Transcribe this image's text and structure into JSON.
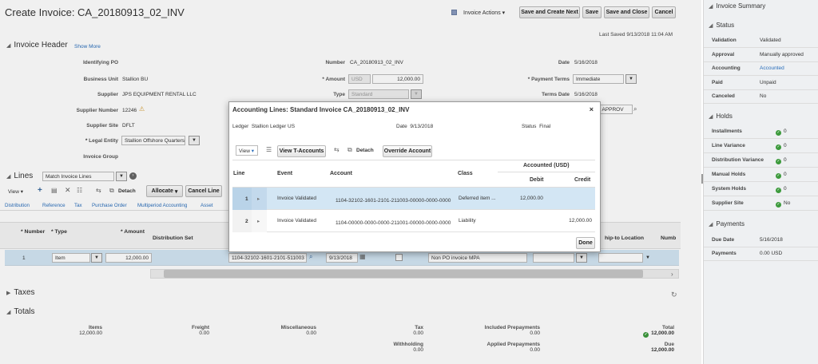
{
  "page": {
    "title": "Create Invoice: CA_20180913_02_INV",
    "invoice_actions": "Invoice Actions",
    "buttons": {
      "save_create_next": "Save and Create Next",
      "save": "Save",
      "save_close": "Save and Close",
      "cancel": "Cancel"
    },
    "last_saved_label": "Last Saved",
    "last_saved_value": "9/13/2018 11:04 AM"
  },
  "header": {
    "section_title": "Invoice Header",
    "show_more": "Show More",
    "fields": {
      "identifying_po": "Identifying PO",
      "business_unit_label": "Business Unit",
      "business_unit": "Stallion BU",
      "supplier_label": "Supplier",
      "supplier": "JPS EQUIPMENT RENTAL LLC",
      "supplier_number_label": "Supplier Number",
      "supplier_number": "12246",
      "supplier_site_label": "Supplier Site",
      "supplier_site": "DFLT",
      "legal_entity_label": "Legal Entity",
      "legal_entity": "Stallion Offshore Quarters,",
      "invoice_group_label": "Invoice Group",
      "number_label": "Number",
      "number": "CA_20180913_02_INV",
      "amount_label": "Amount",
      "amount_currency": "USD",
      "amount": "12,000.00",
      "type_label": "Type",
      "type": "Standard",
      "date_label": "Date",
      "date": "5/16/2018",
      "payment_terms_label": "Payment Terms",
      "payment_terms": "Immediate",
      "terms_date_label": "Terms Date",
      "terms_date": "5/16/2018",
      "required_partial": "01: APPROV"
    }
  },
  "lines": {
    "section_title": "Lines",
    "match_select": "Match Invoice Lines",
    "toolbar": {
      "view": "View",
      "detach": "Detach",
      "allocate": "Allocate",
      "cancel_line": "Cancel Line"
    },
    "tabs": [
      "Distribution",
      "Reference",
      "Tax",
      "Purchase Order",
      "Multiperiod Accounting",
      "Asset"
    ],
    "columns": {
      "number": "Number",
      "type": "Type",
      "amount": "Amount",
      "distribution_set": "Distribution Set",
      "ship_to_location": "hip-to Location",
      "number_trunc": "Numb"
    },
    "row": {
      "number": "1",
      "type": "Item",
      "amount": "12,000.00",
      "distribution_combination": "1104-32102-1601-2101-511003",
      "accounting_date": "9/13/2018",
      "description": "Non PO invoice MPA"
    }
  },
  "taxes": {
    "section_title": "Taxes"
  },
  "totals": {
    "section_title": "Totals",
    "items_label": "Items",
    "items": "12,000.00",
    "freight_label": "Freight",
    "freight": "0.00",
    "misc_label": "Miscellaneous",
    "misc": "0.00",
    "tax_label": "Tax",
    "tax": "0.00",
    "withholding_label": "Withholding",
    "withholding": "0.00",
    "included_prepayments_label": "Included Prepayments",
    "included_prepayments": "0.00",
    "applied_prepayments_label": "Applied Prepayments",
    "applied_prepayments": "0.00",
    "total_label": "Total",
    "total": "12,000.00",
    "due_label": "Due",
    "due": "12,000.00"
  },
  "summary": {
    "title": "Invoice Summary",
    "status_title": "Status",
    "status": [
      {
        "label": "Validation",
        "value": "Validated"
      },
      {
        "label": "Approval",
        "value": "Manually approved"
      },
      {
        "label": "Accounting",
        "value": "Accounted"
      },
      {
        "label": "Paid",
        "value": "Unpaid"
      },
      {
        "label": "Canceled",
        "value": "No"
      }
    ],
    "holds_title": "Holds",
    "holds": [
      {
        "label": "Installments",
        "value": "0"
      },
      {
        "label": "Line Variance",
        "value": "0"
      },
      {
        "label": "Distribution Variance",
        "value": "0"
      },
      {
        "label": "Manual Holds",
        "value": "0"
      },
      {
        "label": "System Holds",
        "value": "0"
      },
      {
        "label": "Supplier Site",
        "value": "No"
      }
    ],
    "payments_title": "Payments",
    "payments": [
      {
        "label": "Due Date",
        "value": "5/16/2018"
      },
      {
        "label": "Payments",
        "value": "0.00 USD"
      }
    ]
  },
  "dialog": {
    "title": "Accounting Lines: Standard Invoice CA_20180913_02_INV",
    "ledger_label": "Ledger",
    "ledger": "Stallion Ledger US",
    "date_label": "Date",
    "date": "9/13/2018",
    "status_label": "Status",
    "status": "Final",
    "toolbar": {
      "view": "View",
      "view_t_accounts": "View T-Accounts",
      "detach": "Detach",
      "override_account": "Override Account"
    },
    "columns": {
      "line": "Line",
      "event": "Event",
      "account": "Account",
      "class": "Class",
      "accounted": "Accounted (USD)",
      "debit": "Debit",
      "credit": "Credit"
    },
    "rows": [
      {
        "line": "1",
        "event": "Invoice Validated",
        "account": "1104-32102-1601-2101-211003-00000-0000-0000",
        "class": "Deferred item ...",
        "debit": "12,000.00",
        "credit": ""
      },
      {
        "line": "2",
        "event": "Invoice Validated",
        "account": "1104-00000-0000-0000-211001-00000-0000-0000",
        "class": "Liability",
        "debit": "",
        "credit": "12,000.00"
      }
    ],
    "done": "Done"
  }
}
